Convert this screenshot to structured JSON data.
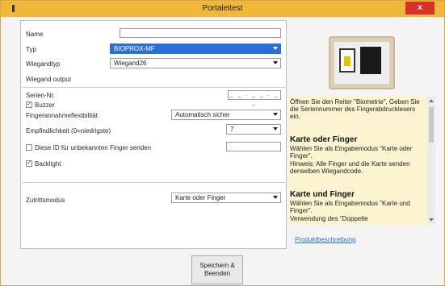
{
  "window": {
    "title": "Portaleitest",
    "close_glyph": "x",
    "app_icon": "app-menu-icon"
  },
  "form": {
    "name_label": "Name",
    "name_value": "",
    "typ_label": "Typ",
    "typ_value": "BIOPROX-MF",
    "wiegandtyp_label": "Wiegandtyp",
    "wiegandtyp_value": "Wiegand26",
    "wiegand_output_label": "Wiegand output",
    "seriennr_label": "Serien-Nr.",
    "seriennr_value": "_ _ . _ _ . _ _",
    "buzzer_label": "Buzzer",
    "buzzer_checked": true,
    "flex_label": "Fingerannahmeflexibilität",
    "flex_value": "Automatisch sicher",
    "sensitivity_label": "Empfindlichkeit (0=niedrigste)",
    "sensitivity_value": "7",
    "unknown_id_label": "Diese ID für unbekannten Finger senden",
    "unknown_id_checked": false,
    "unknown_id_value": "",
    "backlight_label": "Backlight",
    "backlight_checked": true,
    "zutritt_label": "Zutrittsmodus",
    "zutritt_value": "Karte oder Finger",
    "save_label_line1": "Speichern &",
    "save_label_line2": "Beenden"
  },
  "help": {
    "intro": "Öffnen Sie den Reiter \"Biometrie\", Geben Sie die Seriennummer des Fingerabdrucklesers ein.",
    "h1": "Karte oder Finger",
    "p1": "Wählen Sie als Eingabemodus \"Karte oder Finger\".",
    "p1b": "Hinweis: Alle Finger und die Karte senden denselben Wiegandcode.",
    "h2": "Karte und Finger",
    "p2": "Wählen Sie als Eingabemodus \"Karte und Finger\".",
    "p2b": "Verwendung des \"Doppelte",
    "link": "Produktbeschreibung"
  },
  "colors": {
    "title_bar": "#f0b83a",
    "close": "#d9302c",
    "selection": "#2b6fd6",
    "help_bg": "#fcf4d0"
  }
}
